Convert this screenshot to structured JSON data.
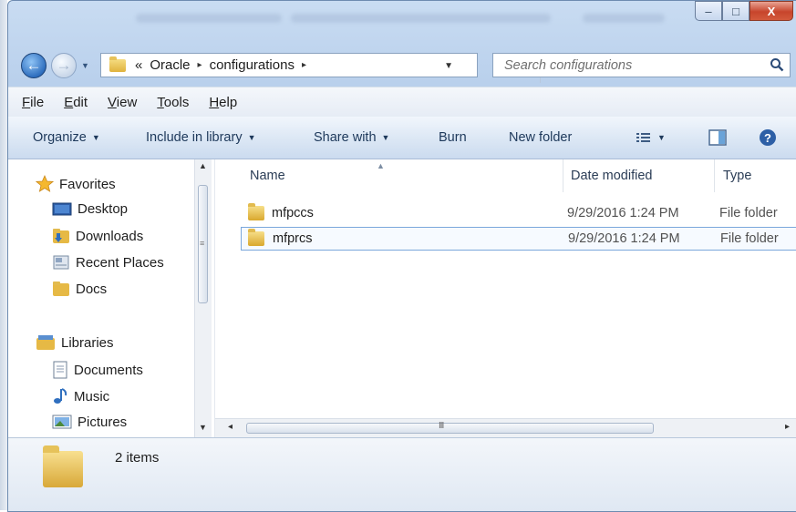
{
  "window": {
    "minimize_glyph": "–",
    "maximize_glyph": "□",
    "close_glyph": "X"
  },
  "nav": {
    "back_glyph": "←",
    "forward_glyph": "→"
  },
  "address": {
    "overflow": "«",
    "crumbs": [
      "Oracle",
      "configurations"
    ],
    "separator": "▸"
  },
  "search": {
    "placeholder": "Search configurations"
  },
  "menu": [
    "File",
    "Edit",
    "View",
    "Tools",
    "Help"
  ],
  "toolbar": {
    "organize": "Organize",
    "include_in_library": "Include in library",
    "share_with": "Share with",
    "burn": "Burn",
    "new_folder": "New folder"
  },
  "sidebar": {
    "favorites_label": "Favorites",
    "favorites": [
      "Desktop",
      "Downloads",
      "Recent Places",
      "Docs"
    ],
    "libraries_label": "Libraries",
    "libraries": [
      "Documents",
      "Music",
      "Pictures"
    ]
  },
  "columns": {
    "name": "Name",
    "date_modified": "Date modified",
    "type": "Type"
  },
  "files": [
    {
      "name": "mfpccs",
      "date": "9/29/2016 1:24 PM",
      "type": "File folder",
      "selected": false
    },
    {
      "name": "mfprcs",
      "date": "9/29/2016 1:24 PM",
      "type": "File folder",
      "selected": true
    }
  ],
  "status": {
    "item_count": "2 items"
  },
  "colors": {
    "accent": "#2f6fbf",
    "selection_border": "#7aa7db",
    "close_button": "#c7452c"
  }
}
